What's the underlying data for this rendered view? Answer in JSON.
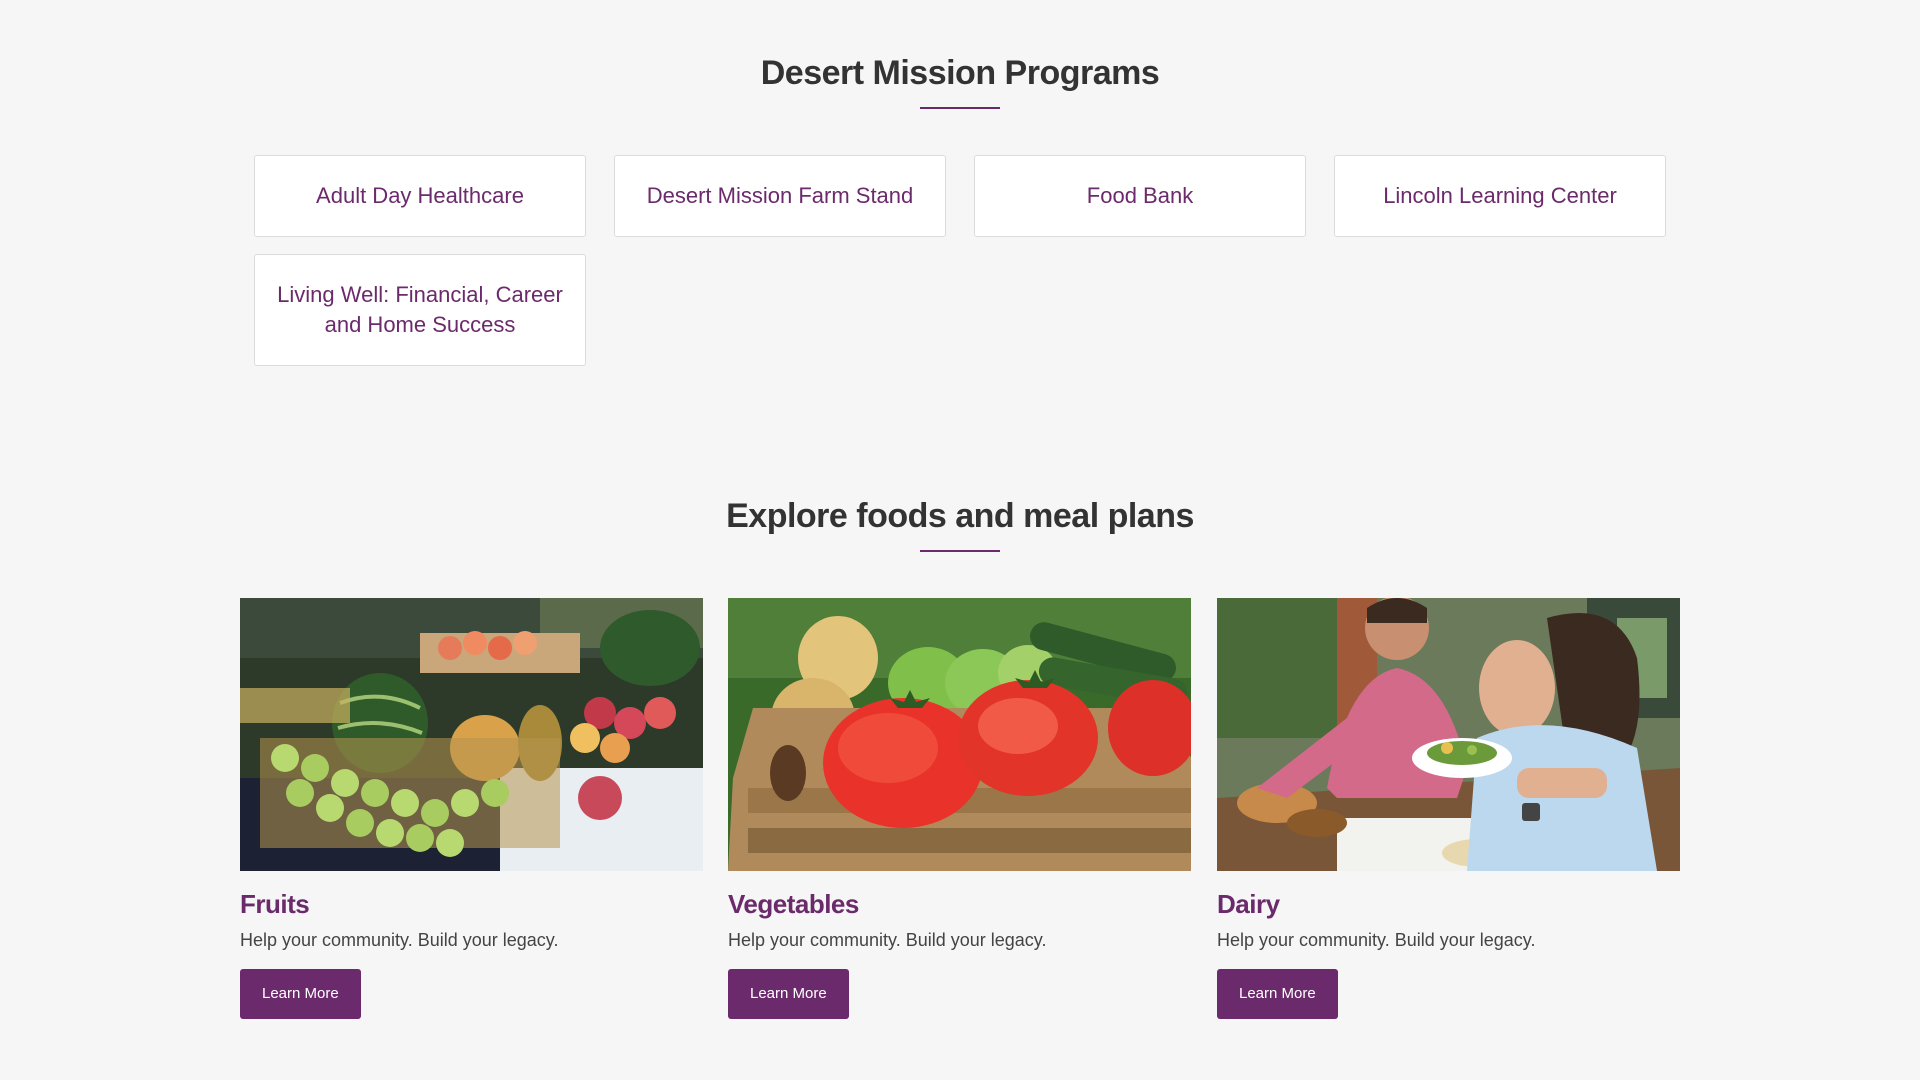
{
  "programs": {
    "title": "Desert Mission Programs",
    "items": [
      {
        "label": "Adult Day Healthcare"
      },
      {
        "label": "Desert Mission Farm Stand"
      },
      {
        "label": "Food Bank"
      },
      {
        "label": "Lincoln Learning Center"
      },
      {
        "label": "Living Well: Financial, Career and Home Success"
      }
    ]
  },
  "explore": {
    "title": "Explore foods and meal plans",
    "cards": [
      {
        "name": "Fruits",
        "description": "Help your community. Build your legacy.",
        "button": "Learn More",
        "image": "fruit-market-photo"
      },
      {
        "name": "Vegetables",
        "description": "Help your community. Build your legacy.",
        "button": "Learn More",
        "image": "tomatoes-crate-photo"
      },
      {
        "name": "Dairy",
        "description": "Help your community. Build your legacy.",
        "button": "Learn More",
        "image": "couple-dining-photo"
      }
    ]
  },
  "colors": {
    "accent": "#6b2a6b",
    "background": "#f6f6f6",
    "heading": "#333333"
  }
}
